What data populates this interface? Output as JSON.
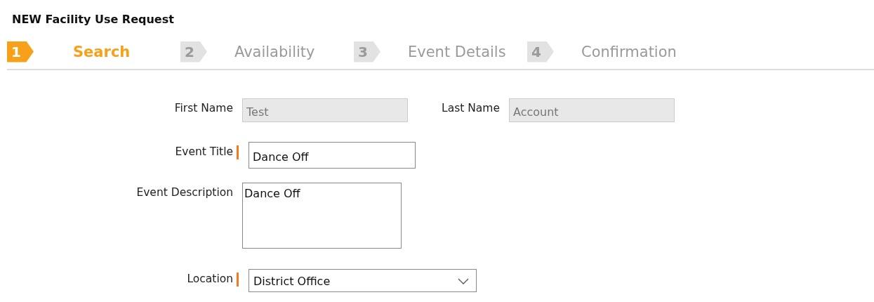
{
  "title": "NEW Facility Use Request",
  "steps": [
    {
      "number": "1",
      "label": "Search",
      "selected": true
    },
    {
      "number": "2",
      "label": "Availability",
      "selected": false
    },
    {
      "number": "3",
      "label": "Event Details",
      "selected": false
    },
    {
      "number": "4",
      "label": "Confirmation",
      "selected": false
    }
  ],
  "rows": [
    {
      "fields": [
        {
          "kind": "text",
          "label": "First Name",
          "value": "Test",
          "disabled": true,
          "required": false
        },
        {
          "kind": "text",
          "label": "Last Name",
          "value": "Account",
          "disabled": true,
          "required": false
        }
      ]
    },
    {
      "fields": [
        {
          "kind": "text",
          "label": "Event Title",
          "value": "Dance Off",
          "disabled": false,
          "required": true
        }
      ]
    },
    {
      "fields": [
        {
          "kind": "textarea",
          "label": "Event Description",
          "value": "Dance Off",
          "disabled": false,
          "required": false
        }
      ]
    },
    {
      "fields": [
        {
          "kind": "select",
          "label": "Location",
          "value": "District Office",
          "disabled": false,
          "required": true
        }
      ]
    }
  ]
}
